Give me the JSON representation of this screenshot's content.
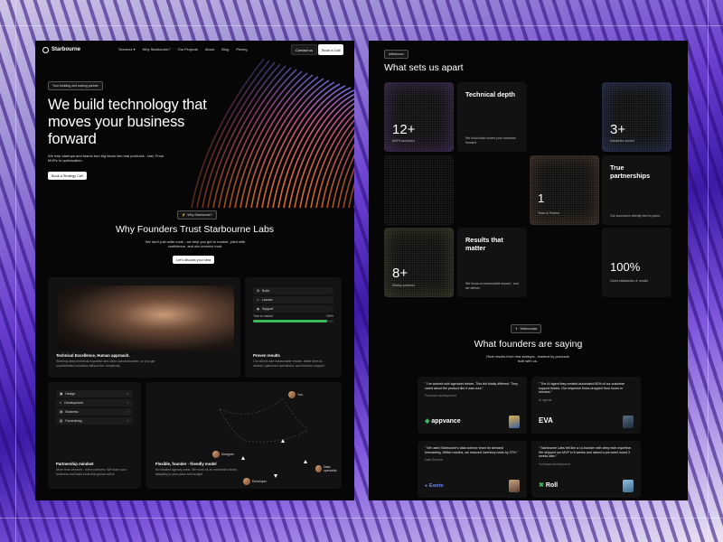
{
  "nav": {
    "brand": "Starbourne",
    "links": [
      "Services ▾",
      "Why Starbourne?",
      "Our Projects",
      "About",
      "Blog",
      "Pricing"
    ],
    "contact_label": "Contact us",
    "book_label": "Book a Call"
  },
  "hero": {
    "badge": "Your building and scaling partner",
    "title": "We build technology that moves your business forward",
    "subtitle": "We help startups and teams turn big ideas into real products - fast. From MVPs to optimization.",
    "cta": "Book a Strategy Call"
  },
  "why": {
    "badge": "Why Starbourne?",
    "title": "Why Founders Trust Starbourne Labs",
    "subtitle": "We don't just write code - we help you get to market, pitch with confidence, and win investor trust.",
    "cta": "Let's discuss your idea"
  },
  "cards": {
    "tech": {
      "title": "Technical Excellence, Human approach.",
      "text": "Working deep technical expertise and clear communication, so you get sophisticated solutions without the complexity."
    },
    "proven": {
      "items": [
        "Build",
        "Launch",
        "Support"
      ],
      "progress_label": "Time to market",
      "progress_value": "+30%",
      "progress_fraction": 0.92,
      "title": "Proven results",
      "text": "Our clients see measurable results: faster time-to-market, optimized operations, and investor support."
    },
    "partnership": {
      "rows": [
        "Design",
        "Development",
        "Business",
        "Fundraising"
      ],
      "row_mark": "✓",
      "title": "Partnership mindset",
      "text": "More than vendors - we're partners. We learn your business and build tools that grows with it."
    },
    "flexible": {
      "nodes": [
        "You",
        "Designer",
        "Data specialist",
        "Developer"
      ],
      "title": "Flexible, founder - friendly model",
      "text": "No bloated agency costs. We work as an embedded team, adapting to your pace and budget."
    }
  },
  "apart": {
    "badge": "Milestones",
    "title": "What sets us apart",
    "cells": [
      {
        "big": "12+",
        "small": "MVPs launched"
      },
      {
        "title": "Technical depth",
        "desc": "We build what moves your business forward."
      },
      {
        "big": "3+",
        "small": "Industries served"
      },
      {
        "big": "1",
        "small": "Team & Partner"
      },
      {
        "title": "True partnerships",
        "desc": "Our success is directly tied to yours."
      },
      {
        "big": "8+",
        "small": "Startup partners"
      },
      {
        "title": "Results that matter",
        "desc": "We focus on measurable impact - and we deliver."
      },
      {
        "big": "100%",
        "small": "Client satisfaction & results"
      }
    ]
  },
  "testimonials": {
    "badge": "Testimonials",
    "title": "What founders are saying",
    "subtitle": "Real results from real startups - backed by products built with us.",
    "items": [
      {
        "quote": "\" I've worked with agencies before. This felt totally different. They cared about the product like it was ours.\"",
        "role": "Full stack development",
        "logo": "appvance"
      },
      {
        "quote": "\" The AI agent they created automated 80% of our customer support tickets. Our response times dropped from hours to minutes.\"",
        "role": "AI agents",
        "logo": "EVA"
      },
      {
        "quote": "\" We used Starbourne's data science team for demand forecasting. Within months, we reduced inventory costs by 27%.\"",
        "role": "Data Science",
        "logo": "Exerto"
      },
      {
        "quote": "\" Starbourne Labs felt like a co-founder with deep tech expertise. We shipped our MVP in 6 weeks and raised a pre-seed round 3 weeks later.\"",
        "role": "Full stack development",
        "logo": "Roll"
      }
    ]
  },
  "colors": {
    "accent_green": "#3dbb5b",
    "accent_purple": "#7b4bd8"
  }
}
